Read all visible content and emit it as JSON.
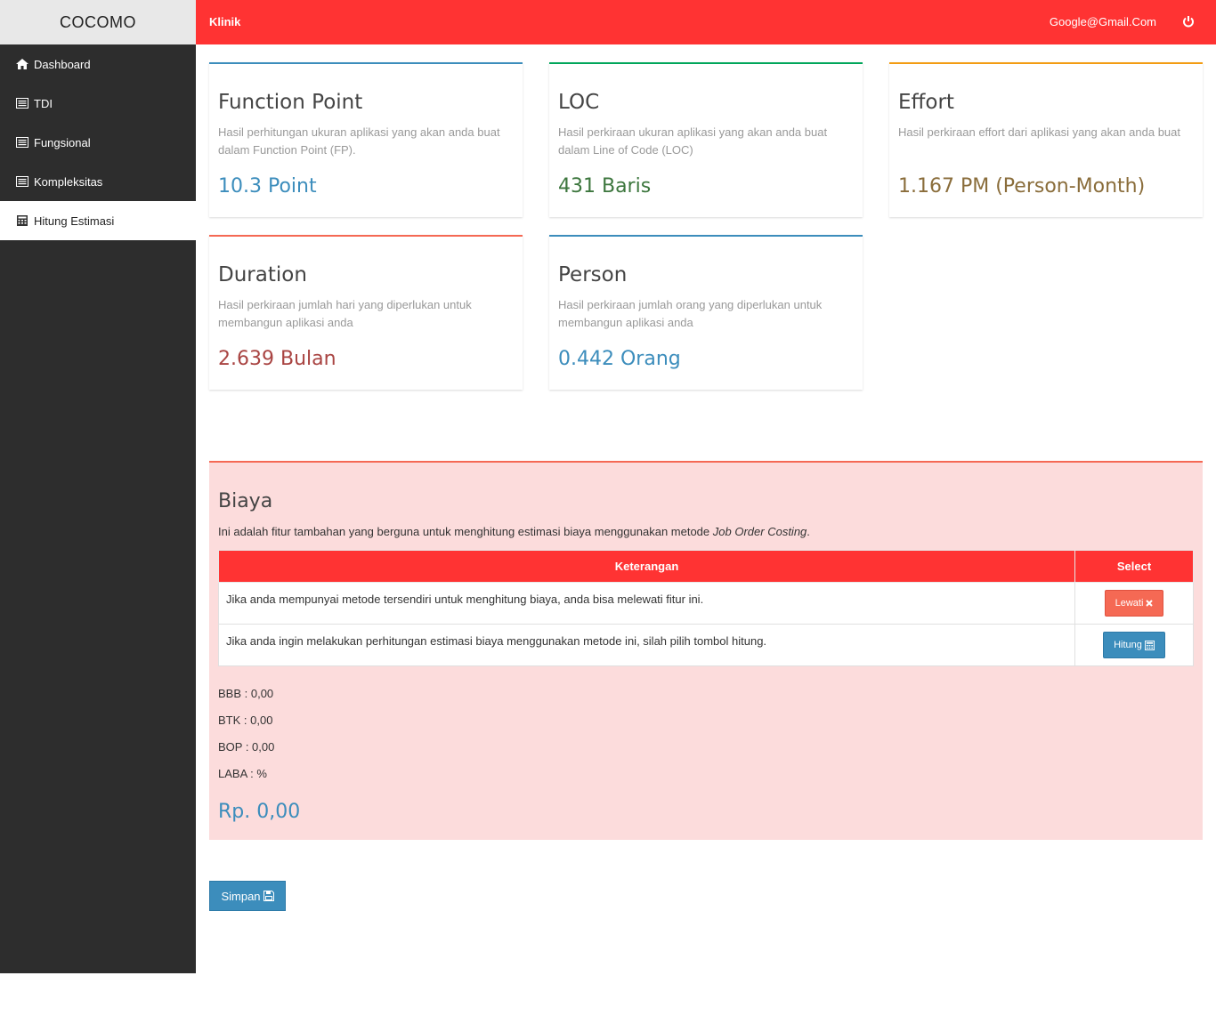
{
  "brand": "COCOMO",
  "topbar": {
    "title": "Klinik",
    "email": "Google@Gmail.Com"
  },
  "sidebar": {
    "items": [
      {
        "label": "Dashboard",
        "icon": "home-icon"
      },
      {
        "label": "TDI",
        "icon": "list-icon"
      },
      {
        "label": "Fungsional",
        "icon": "list-icon"
      },
      {
        "label": "Kompleksitas",
        "icon": "list-icon"
      },
      {
        "label": "Hitung Estimasi",
        "icon": "calculator-icon",
        "active": true
      }
    ]
  },
  "cards": [
    {
      "title": "Function Point",
      "desc": "Hasil perhitungan ukuran aplikasi yang akan anda buat dalam Function Point (FP).",
      "value": "10.3 Point",
      "border": "#3c8dbc",
      "color": "#3c8dbc"
    },
    {
      "title": "LOC",
      "desc": "Hasil perkiraan ukuran aplikasi yang akan anda buat dalam Line of Code (LOC)",
      "value": "431 Baris",
      "border": "#00a65a",
      "color": "#3c763d"
    },
    {
      "title": "Effort",
      "desc": "Hasil perkiraan effort dari aplikasi yang akan anda buat",
      "value": "1.167 PM (Person-Month)",
      "border": "#f39c12",
      "color": "#8a6d3b"
    },
    {
      "title": "Duration",
      "desc": "Hasil perkiraan jumlah hari yang diperlukan untuk membangun aplikasi anda",
      "value": "2.639 Bulan",
      "border": "#f56954",
      "color": "#a94442"
    },
    {
      "title": "Person",
      "desc": "Hasil perkiraan jumlah orang yang diperlukan untuk membangun aplikasi anda",
      "value": "0.442 Orang",
      "border": "#3c8dbc",
      "color": "#3c8dbc"
    }
  ],
  "biaya": {
    "title": "Biaya",
    "desc": "Ini adalah fitur tambahan yang berguna untuk menghitung estimasi biaya menggunakan metode",
    "desc_em": "Job Order Costing",
    "desc_end": ".",
    "table": {
      "headers": [
        "Keterangan",
        "Select"
      ],
      "rows": [
        {
          "text": "Jika anda mempunyai metode tersendiri untuk menghitung biaya, anda bisa melewati fitur ini.",
          "button": "Lewati"
        },
        {
          "text": "Jika anda ingin melakukan perhitungan estimasi biaya menggunakan metode ini, silah pilih tombol hitung.",
          "button": "Hitung"
        }
      ]
    },
    "bbb": "BBB : 0,00",
    "btk": "BTK : 0,00",
    "bop": "BOP : 0,00",
    "laba": "LABA : %",
    "total": "Rp. 0,00"
  },
  "save_label": "Simpan"
}
